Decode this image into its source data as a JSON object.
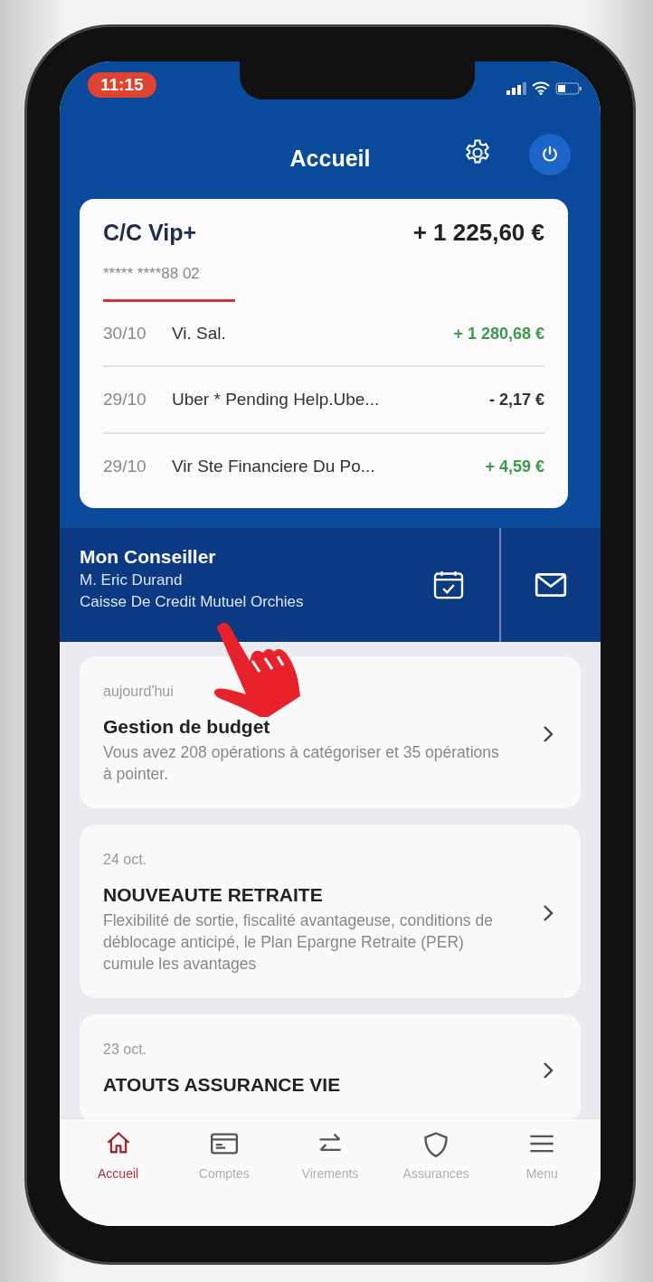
{
  "status_bar": {
    "time": "11:15"
  },
  "header": {
    "title": "Accueil"
  },
  "account": {
    "name": "C/C Vip+",
    "balance": "+ 1 225,60 €",
    "number": "***** ****88 02",
    "transactions": [
      {
        "date": "30/10",
        "label": "Vi. Sal.",
        "amount": "+ 1 280,68 €",
        "kind": "credit"
      },
      {
        "date": "29/10",
        "label": "Uber * Pending Help.Ube...",
        "amount": "- 2,17 €",
        "kind": "debit"
      },
      {
        "date": "29/10",
        "label": "Vir Ste Financiere Du Po...",
        "amount": "+ 4,59 €",
        "kind": "credit"
      }
    ]
  },
  "advisor": {
    "heading": "Mon Conseiller",
    "name": "M. Eric Durand",
    "branch": "Caisse De Credit Mutuel Orchies"
  },
  "notifications": [
    {
      "date": "aujourd'hui",
      "title": "Gestion de budget",
      "text": "Vous avez 208 opérations à catégoriser et 35 opérations à pointer."
    },
    {
      "date": "24 oct.",
      "title": "NOUVEAUTE RETRAITE",
      "text": "Flexibilité de sortie, fiscalité avantageuse, conditions de déblocage anticipé, le Plan Epargne Retraite (PER) cumule les avantages"
    },
    {
      "date": "23 oct.",
      "title": "ATOUTS ASSURANCE VIE"
    }
  ],
  "tab_bar": [
    {
      "label": "Accueil",
      "selected": true
    },
    {
      "label": "Comptes",
      "selected": false
    },
    {
      "label": "Virements",
      "selected": false
    },
    {
      "label": "Assurances",
      "selected": false
    },
    {
      "label": "Menu",
      "selected": false
    }
  ]
}
